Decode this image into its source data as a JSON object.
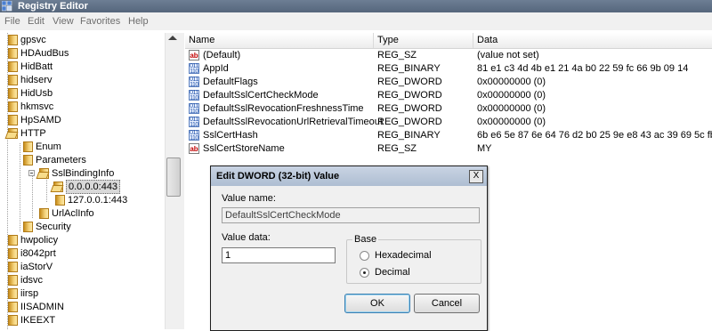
{
  "window": {
    "title": "Registry Editor"
  },
  "menu": [
    "File",
    "Edit",
    "View",
    "Favorites",
    "Help"
  ],
  "tree": [
    {
      "label": "gpsvc"
    },
    {
      "label": "HDAudBus"
    },
    {
      "label": "HidBatt"
    },
    {
      "label": "hidserv"
    },
    {
      "label": "HidUsb"
    },
    {
      "label": "hkmsvc"
    },
    {
      "label": "HpSAMD"
    },
    {
      "label": "HTTP"
    },
    {
      "label": "Enum"
    },
    {
      "label": "Parameters"
    },
    {
      "label": "SslBindingInfo"
    },
    {
      "label": "0.0.0.0:443"
    },
    {
      "label": "127.0.0.1:443"
    },
    {
      "label": "UrlAclInfo"
    },
    {
      "label": "Security"
    },
    {
      "label": "hwpolicy"
    },
    {
      "label": "i8042prt"
    },
    {
      "label": "iaStorV"
    },
    {
      "label": "idsvc"
    },
    {
      "label": "iirsp"
    },
    {
      "label": "IISADMIN"
    },
    {
      "label": "IKEEXT"
    }
  ],
  "list": {
    "headers": {
      "name": "Name",
      "type": "Type",
      "data": "Data"
    },
    "rows": [
      {
        "icon": "string-value-icon",
        "name": "(Default)",
        "type": "REG_SZ",
        "data": "(value not set)"
      },
      {
        "icon": "binary-value-icon",
        "name": "AppId",
        "type": "REG_BINARY",
        "data": "81 e1 c3 4d 4b e1 21 4a b0 22 59 fc 66 9b 09 14"
      },
      {
        "icon": "binary-value-icon",
        "name": "DefaultFlags",
        "type": "REG_DWORD",
        "data": "0x00000000 (0)"
      },
      {
        "icon": "binary-value-icon",
        "name": "DefaultSslCertCheckMode",
        "type": "REG_DWORD",
        "data": "0x00000000 (0)"
      },
      {
        "icon": "binary-value-icon",
        "name": "DefaultSslRevocationFreshnessTime",
        "type": "REG_DWORD",
        "data": "0x00000000 (0)"
      },
      {
        "icon": "binary-value-icon",
        "name": "DefaultSslRevocationUrlRetrievalTimeout",
        "type": "REG_DWORD",
        "data": "0x00000000 (0)"
      },
      {
        "icon": "binary-value-icon",
        "name": "SslCertHash",
        "type": "REG_BINARY",
        "data": "6b e6 5e 87 6e 64 76 d2 b0 25 9e e8 43 ac 39 69 5c fb..."
      },
      {
        "icon": "string-value-icon",
        "name": "SslCertStoreName",
        "type": "REG_SZ",
        "data": "MY"
      }
    ]
  },
  "dialog": {
    "title": "Edit DWORD (32-bit) Value",
    "close": "X",
    "value_name_label": "Value name:",
    "value_name": "DefaultSslCertCheckMode",
    "value_data_label": "Value data:",
    "value_data": "1",
    "base_label": "Base",
    "hex_label": "Hexadecimal",
    "dec_label": "Decimal",
    "base_selected": "Decimal",
    "ok": "OK",
    "cancel": "Cancel"
  }
}
